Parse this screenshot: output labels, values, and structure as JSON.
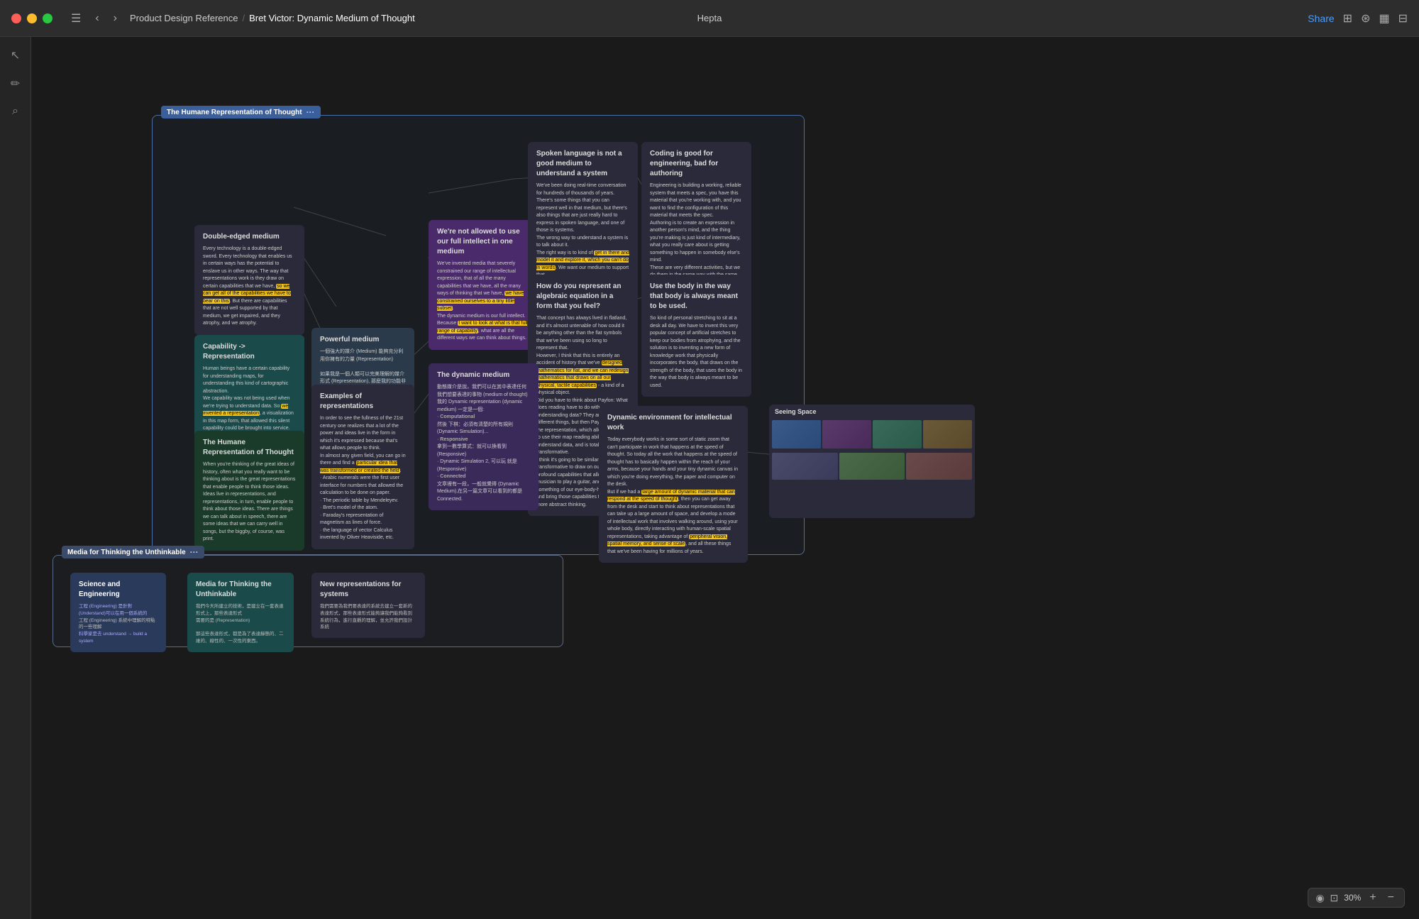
{
  "titlebar": {
    "app_name": "Hepta",
    "breadcrumb_parent": "Product Design Reference",
    "breadcrumb_separator": "/",
    "breadcrumb_current": "Bret Victor: Dynamic Medium of Thought",
    "share_label": "Share"
  },
  "sidebar": {
    "icons": [
      "☰",
      "←",
      "→",
      "✎",
      "🔍"
    ]
  },
  "canvas": {
    "group1": {
      "label": "The Humane Representation of Thought",
      "label_dots": "···"
    },
    "group2": {
      "label": "Media for Thinking the Unthinkable",
      "label_dots": "···"
    }
  },
  "nodes": {
    "humane_representation": {
      "title": "The Humane Representation of Thought",
      "text": "When you're thinking of the great ideas of history, often what you really want to be thinking about is the great representations that enable people to think those ideas. Ideas live in representations, and representations, in turn, enable people to think about those ideas. There are things we can talk about in speech, there are some ideas that we can carry well in songs, but the biggby, of course, was print."
    },
    "double_edged": {
      "title": "Double-edged medium",
      "text": "Every technology is a double-edged sword. Every technology that enables us in certain ways has the potential to enslave us in other ways. The way that representations work is they draw on certain capabilities that we have, so the can get all of the capabilities we have to bear on this. But there are capabilities that are not well supported by that medium, we get impaired, and they atrophy, and we atrophy."
    },
    "capability_rep": {
      "title": "Capability -> Representation",
      "text": "Human beings have a certain capability for understanding maps, for understanding this kind of cartographic abstraction. We capability was not being used when we're trying to understand data. So we invented a representation, a visualization in this map form, that allowed this silent capability could be brought into service. Indeed Engelbart's ideas about Capability 一系列一."
    },
    "powerful_medium": {
      "title": "Powerful medium",
      "text": "一個強大的媒介 (Medium) 能夠充分利用你擁有的力量 (Representation)\n\n如果我是一個人類可以完美理解的媒介形式 (Representation), 那麼我的功能非常相似 (Same mode)\nSame as you, same as you, you're on (Unconstrained in structure)."
    },
    "not_allowed": {
      "title": "We're not allowed to use our full intellect in one medium",
      "text": "We've invented media that severely constrained our range of intellectual expression, that of all the many capabilities that we have, all the many ways of thinking that we have, we have constrained ourselves to a tiny little subset.\nThe dynamic medium is our full intellect. Because I want to look at what is that full range of capability, what are all the different ways we can think about things."
    },
    "spoken_language": {
      "title": "Spoken language is not a good medium to understand a system",
      "text": "We've been doing real-time conversation for hundreds of thousands of years. There's some things that you can represent well in that medium, but there's also things that are just really hard to express in spoken language, and one of those is systems.\nThe wrong way to understand a system is to talk about it.\nThe right way is to kind of get in there and model it and explore it, which you can't do in words. We want our medium to support that."
    },
    "coding_good": {
      "title": "Coding is good for engineering, bad for authoring",
      "text": "Engineering is building a working, reliable system that meets a spec, you have this material that you're working with, and you want to find the configuration of this material that meets the spec.\nAuthoring is to create an expression in another person's mind, and the thing you're making is just kind of intermediary, what you really care about is getting something to happen in somebody else's mind.\nThese are very different activities, but we do them in the same way with the same tools, both of them just kind of writing code.\nI think we need to disentangle those.\nI don't think coding is an appropriate way of authoring."
    },
    "examples_rep": {
      "title": "Examples of representations",
      "text": "In order to see the fullness of the 21st century one realizes that a lot of the power and ideas live in the form in which it's expressed because that's what allows people to think.\nIn almost any given field, you can go in there and find a particular idea that was transformed or created the field.\n· Arabic numerals were the first user interface for numbers that allowed the calculation to be done on paper.\n· The periodic table by Mendeleyev.\n· Bret's model of the atom.\n· Faraday's representation of magnetism as lines of force.\n· the language of vector Calculus invented by Oliver Heaviside, etc."
    },
    "algebraic_equation": {
      "title": "How do you represent an algebraic equation in a form that you feel?",
      "text": "That concept has always lived in flatland, and it's almost untenable of how could it be anything other than the flat symbols that we've been using so long to represent that.\nHowever, I think that this is entirely an accident of history that we've designed mathematics for flat, and we can redesign mathematics that draws on all our physical, tactile capabilities - a kind of a physical object.\nDid you have to think about Payfon: What does reading have to do with understanding data? They are totally different things, but then Payfon invented the representation, which allowed people to use their map reading ability to understand data, and is totally transformative.\nI think it's going to be similarly transformative to draw on our worldwide profound capabilities that allow us to be a musician to play a guitar, and to use something of our eye-body-hand skills and bring those capabilities to bear on more abstract thinking."
    },
    "use_body": {
      "title": "Use the body in the way that body is always meant to be used.",
      "text": "So kind of personal stretching to sit at a desk all day. We have to invent this very popular concept of artificial stretches to keep our bodies from atrophying, and the solution is to inventing a new form of knowledge work that physically incorporates the body, that draws on the strength of the body, that uses the body in the way that body is always meant to be used."
    },
    "dynamic_medium": {
      "title": "The dynamic medium",
      "text": "動態媒介是說，我們可以在其中表達任何我們想要表達的事物 (medium of thought)\n我的 Dynamic representation (dynamic medium) 一定是一個:\n· Computational\n然後 下棋：必須有清楚的所有規則 (Dynamic Simulation)...\n· Responsive\n拿到一數學算式：就可以換看到 (Responsive)\n· Dynamic Simulation 2, 可以玩 就是 (Responsive)\n· Connected\n文章裡有一段，一般就覺得 (Dynamic Medium),在另一篇文章可以看到的都是 Connected."
    },
    "dynamic_environment": {
      "title": "Dynamic environment for intellectual work",
      "text": "Today everybody works in some sort of static zoom that can't participate in work that happens at the speed of thought. So today all the work that happens at the speed of thought has to basically happen within the reach of your arms, because your hands and your tiny dynamic canvas in which you're doing everything, the paper and computer on the desk.\nBut what if we had a large amount of dynamic material that can respond at the speed of thought, then you can get away from the desk and start to think about representations that can take up a large amount of space, and develop a mode of intellectual work that involves walking around, using your whole body, directly interacting with human-scale spatial representations, taking advantage of peripheral vision, spatial memory, and sense of scale, and all these things that we've been having for millions of years."
    },
    "seeing_space": {
      "title": "Seeing Space"
    },
    "science_engineering": {
      "title": "Science and Engineering",
      "text": ""
    },
    "media_thinking": {
      "title": "Media for Thinking the Unthinkable",
      "text": ""
    },
    "new_representations": {
      "title": "New representations for systems",
      "text": ""
    }
  },
  "zoom": {
    "percent": "30%",
    "minus": "−",
    "plus": "+"
  }
}
